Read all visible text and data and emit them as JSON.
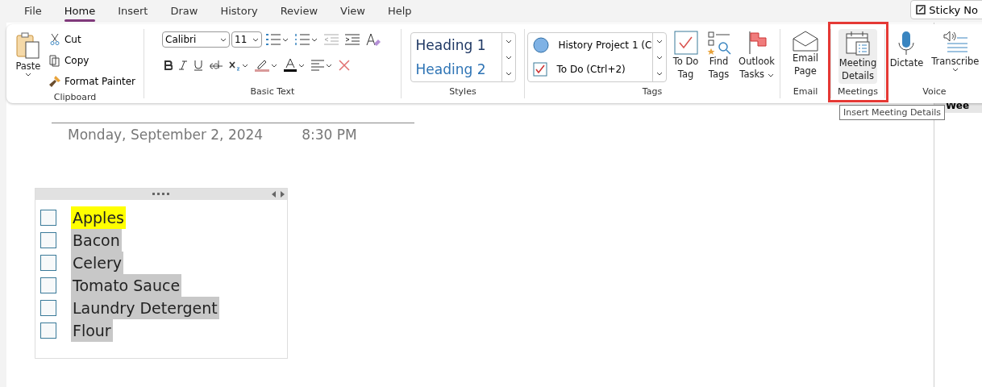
{
  "menu_tabs": [
    {
      "label": "File",
      "selected": false
    },
    {
      "label": "Home",
      "selected": true
    },
    {
      "label": "Insert",
      "selected": false
    },
    {
      "label": "Draw",
      "selected": false
    },
    {
      "label": "History",
      "selected": false
    },
    {
      "label": "Review",
      "selected": false
    },
    {
      "label": "View",
      "selected": false
    },
    {
      "label": "Help",
      "selected": false
    }
  ],
  "sticky_notes": "Sticky No",
  "clipboard": {
    "paste": "Paste",
    "items": [
      {
        "label": "Cut",
        "kind": "cut"
      },
      {
        "label": "Copy",
        "kind": "copy"
      },
      {
        "label": "Format Painter",
        "kind": "painter"
      }
    ],
    "label": "Clipboard"
  },
  "basic_text": {
    "font": "Calibri",
    "size": "11",
    "label": "Basic Text"
  },
  "styles": {
    "items": [
      "Heading 1",
      "Heading 2"
    ],
    "label": "Styles"
  },
  "tags": {
    "items": [
      {
        "label": "History Project 1 (C",
        "kind": "circle"
      },
      {
        "label": "To Do (Ctrl+2)",
        "kind": "check"
      }
    ],
    "buttons": [
      {
        "label": "To Do Tag",
        "kind": "todo"
      },
      {
        "label": "Find Tags",
        "kind": "find"
      },
      {
        "label": "Outlook Tasks",
        "kind": "flag"
      }
    ],
    "label": "Tags"
  },
  "email": {
    "button": "Email Page",
    "label": "Email"
  },
  "meetings": {
    "button": "Meeting Details",
    "label": "Meetings",
    "highlighted": true
  },
  "voice": {
    "buttons": [
      {
        "label": "Dictate",
        "kind": "mic"
      },
      {
        "label": "Transcribe",
        "kind": "transcribe"
      }
    ],
    "label": "Voice"
  },
  "tooltip": "Insert Meeting Details",
  "page": {
    "date": "Monday, September 2, 2024",
    "time": "8:30 PM",
    "items": [
      {
        "text": "Apples",
        "checked": false,
        "highlighted": true,
        "selected": false
      },
      {
        "text": "Bacon",
        "checked": false,
        "highlighted": false,
        "selected": true
      },
      {
        "text": "Celery",
        "checked": false,
        "highlighted": false,
        "selected": true
      },
      {
        "text": "Tomato Sauce",
        "checked": false,
        "highlighted": false,
        "selected": true
      },
      {
        "text": "Laundry Detergent",
        "checked": false,
        "highlighted": false,
        "selected": true
      },
      {
        "text": "Flour",
        "checked": false,
        "highlighted": false,
        "selected": true
      }
    ]
  },
  "page_list": {
    "item": "Wee"
  }
}
